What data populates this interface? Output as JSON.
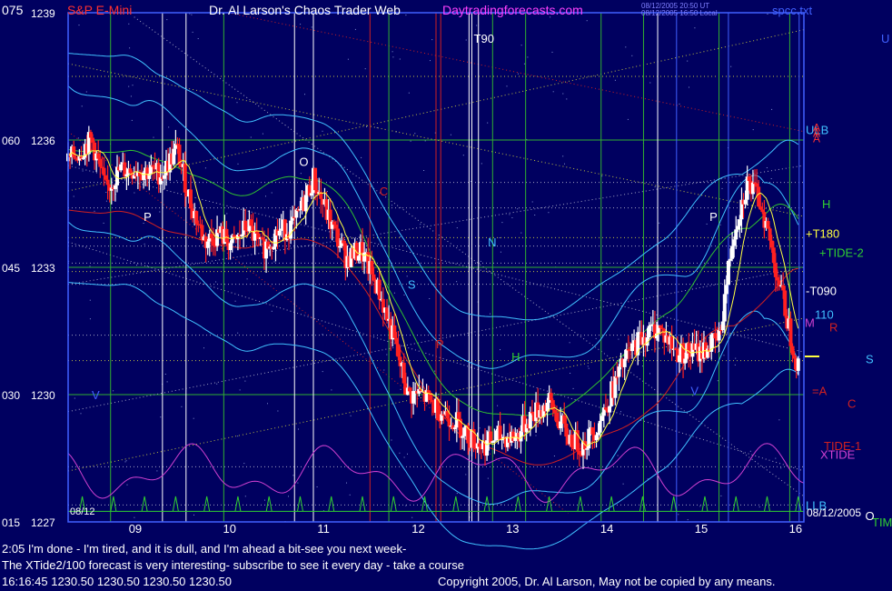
{
  "header": {
    "symbol": "S&P E-Mini",
    "title": "Dr. Al Larson's Chaos Trader Web",
    "site": "Daytradingforecasts.com",
    "stamp_line1": "08/12/2005 20:50 UT",
    "stamp_line2": "08/12/2005 16:50 Local",
    "file": "spcc.txt"
  },
  "footer": {
    "line1": "2:05 I'm done - I'm tired, and it is dull, and I'm ahead a bit-see you next week-",
    "line2": "The XTide2/100 forecast is very interesting- subscribe to see it every day - take a course",
    "line3": "16:16:45   1230.50  1230.50  1230.50  1230.50",
    "copyright": "Copyright 2005, Dr. Al Larson, May not be copied by any means."
  },
  "colors": {
    "background": "#000060",
    "price_up": "#ffffff",
    "price_down": "#ff2020",
    "fast_ma": "#ffff40",
    "channel": "#40c0ff",
    "green_band": "#30c030",
    "red_band": "#d02020",
    "tide": "#d040d0",
    "spikes": "#30d030"
  },
  "chart_data": {
    "type": "candlestick",
    "x_ticks": [
      "09",
      "10",
      "11",
      "12",
      "13",
      "14",
      "15",
      "16"
    ],
    "x_range": [
      8.3,
      16.1
    ],
    "y_left_ticks": [
      {
        "left": "075",
        "price": "1239",
        "value": 1239
      },
      {
        "left": "060",
        "price": "1236",
        "value": 1236
      },
      {
        "left": "045",
        "price": "1233",
        "value": 1233
      },
      {
        "left": "030",
        "price": "1230",
        "value": 1230
      },
      {
        "left": "015",
        "price": "1227",
        "value": 1227
      }
    ],
    "y_range": [
      1227,
      1239
    ],
    "start_label": "08/12",
    "end_label": "08/12/2005",
    "price_knots": [
      [
        8.3,
        1235.5
      ],
      [
        8.55,
        1236.0
      ],
      [
        8.7,
        1234.8
      ],
      [
        8.85,
        1235.3
      ],
      [
        9.05,
        1235.3
      ],
      [
        9.3,
        1235.2
      ],
      [
        9.45,
        1235.8
      ],
      [
        9.6,
        1234.5
      ],
      [
        9.75,
        1233.6
      ],
      [
        9.9,
        1233.8
      ],
      [
        10.05,
        1233.5
      ],
      [
        10.2,
        1234.0
      ],
      [
        10.35,
        1233.4
      ],
      [
        10.5,
        1233.8
      ],
      [
        10.7,
        1234.0
      ],
      [
        10.9,
        1235.1
      ],
      [
        11.05,
        1234.2
      ],
      [
        11.25,
        1233.2
      ],
      [
        11.4,
        1233.4
      ],
      [
        11.6,
        1232.4
      ],
      [
        11.75,
        1231.3
      ],
      [
        11.9,
        1230.0
      ],
      [
        12.05,
        1230.0
      ],
      [
        12.2,
        1229.7
      ],
      [
        12.4,
        1229.4
      ],
      [
        12.55,
        1229.0
      ],
      [
        12.7,
        1228.8
      ],
      [
        12.85,
        1229.0
      ],
      [
        13.05,
        1229.0
      ],
      [
        13.2,
        1229.5
      ],
      [
        13.4,
        1229.8
      ],
      [
        13.6,
        1229.0
      ],
      [
        13.75,
        1228.8
      ],
      [
        13.92,
        1229.3
      ],
      [
        14.05,
        1230.0
      ],
      [
        14.2,
        1230.8
      ],
      [
        14.35,
        1231.3
      ],
      [
        14.55,
        1231.6
      ],
      [
        14.75,
        1231.0
      ],
      [
        15.0,
        1231.0
      ],
      [
        15.2,
        1231.3
      ],
      [
        15.35,
        1233.8
      ],
      [
        15.5,
        1235.0
      ],
      [
        15.65,
        1234.5
      ],
      [
        15.8,
        1233.0
      ],
      [
        15.95,
        1231.5
      ],
      [
        16.05,
        1230.5
      ]
    ],
    "last_price": 1230.5,
    "level_labels": [
      {
        "text": "ULB",
        "color": "#40c0ff",
        "price": 1236.25
      },
      {
        "text": "H",
        "color": "#30d030",
        "price": 1234.5
      },
      {
        "text": "+T180",
        "color": "#ffff40",
        "price": 1233.8
      },
      {
        "text": "+TIDE-2",
        "color": "#30d030",
        "price": 1233.35
      },
      {
        "text": "-T090",
        "color": "#ffffff",
        "price": 1232.45
      },
      {
        "text": "110",
        "color": "#40c0ff",
        "price": 1231.9
      },
      {
        "text": "M",
        "color": "#d040d0",
        "price": 1231.7
      },
      {
        "text": "R",
        "color": "#d02020",
        "price": 1231.6
      },
      {
        "text": "S",
        "color": "#40c0ff",
        "price": 1230.85
      },
      {
        "text": "=A",
        "color": "#d02020",
        "price": 1230.1
      },
      {
        "text": "C",
        "color": "#d02020",
        "price": 1229.8
      },
      {
        "text": "TIDE-1",
        "color": "#d02020",
        "price": 1228.8
      },
      {
        "text": "XTIDE",
        "color": "#d040d0",
        "price": 1228.6
      },
      {
        "text": "LLB",
        "color": "#40c0ff",
        "price": 1227.4
      },
      {
        "text": "TIM",
        "color": "#30d030",
        "price": 1227.0
      },
      {
        "text": "U",
        "color": "#4060ff",
        "price": 1238.4
      }
    ],
    "top_markers": [
      "A",
      "A",
      "A"
    ],
    "chart_labels": [
      {
        "text": "T90",
        "color": "#ffffff",
        "x": 12.6,
        "price": 1238.4
      },
      {
        "text": "O",
        "color": "#ffffff",
        "x": 10.75,
        "price": 1235.5
      },
      {
        "text": "C",
        "color": "#d02020",
        "x": 11.6,
        "price": 1234.8
      },
      {
        "text": "P",
        "color": "#ffffff",
        "x": 9.1,
        "price": 1234.2
      },
      {
        "text": "N",
        "color": "#40c0ff",
        "x": 12.75,
        "price": 1233.6
      },
      {
        "text": "S",
        "color": "#40c0ff",
        "x": 11.9,
        "price": 1232.6
      },
      {
        "text": "P",
        "color": "#d02020",
        "x": 12.2,
        "price": 1231.2
      },
      {
        "text": "H",
        "color": "#30d030",
        "x": 13.0,
        "price": 1230.9
      },
      {
        "text": "V",
        "color": "#4060ff",
        "x": 8.55,
        "price": 1230.0
      },
      {
        "text": "P",
        "color": "#ffffff",
        "x": 15.1,
        "price": 1234.2
      },
      {
        "text": "V",
        "color": "#4060ff",
        "x": 14.9,
        "price": 1230.1
      },
      {
        "text": "O",
        "color": "#ffffff",
        "x": 16.75,
        "price": 1227.15
      }
    ]
  }
}
